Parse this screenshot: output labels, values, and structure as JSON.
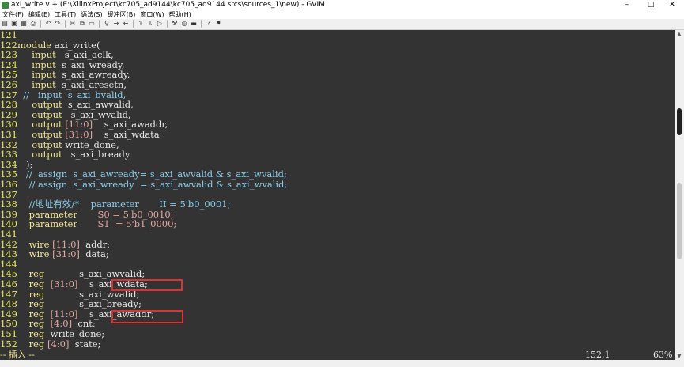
{
  "window": {
    "title": "axi_write.v + (E:\\XilinxProject\\kc705_ad9144\\kc705_ad9144.srcs\\sources_1\\new) - GVIM",
    "buttons": {
      "minimize": "–",
      "maximize": "□",
      "close": "✕"
    }
  },
  "menu": [
    "文件(F)",
    "编辑(E)",
    "工具(T)",
    "语法(S)",
    "缓冲区(B)",
    "窗口(W)",
    "帮助(H)"
  ],
  "toolbar_icons": [
    "open-icon",
    "save-icon",
    "save-all-icon",
    "print-icon",
    "undo-icon",
    "redo-icon",
    "cut-icon",
    "copy-icon",
    "paste-icon",
    "find-replace-icon",
    "find-next-icon",
    "find-prev-icon",
    "load-session-icon",
    "save-session-icon",
    "run-script-icon",
    "make-icon",
    "run-ctags-icon",
    "jump-tag-icon",
    "help-icon",
    "find-help-icon"
  ],
  "code": [
    {
      "n": "121",
      "t": []
    },
    {
      "n": "122",
      "t": [
        [
          "kw",
          "module "
        ],
        [
          "idn",
          "axi_write("
        ]
      ]
    },
    {
      "n": "123",
      "t": [
        [
          "idn",
          "     "
        ],
        [
          "typ",
          "input"
        ],
        [
          "idn",
          "   s_axi_aclk,"
        ]
      ]
    },
    {
      "n": "124",
      "t": [
        [
          "idn",
          "     "
        ],
        [
          "typ",
          "input"
        ],
        [
          "idn",
          "  s_axi_wready,"
        ]
      ]
    },
    {
      "n": "125",
      "t": [
        [
          "idn",
          "     "
        ],
        [
          "typ",
          "input"
        ],
        [
          "idn",
          "  s_axi_awready,"
        ]
      ]
    },
    {
      "n": "126",
      "t": [
        [
          "idn",
          "     "
        ],
        [
          "typ",
          "input"
        ],
        [
          "idn",
          "  s_axi_aresetn,"
        ]
      ]
    },
    {
      "n": "127",
      "t": [
        [
          "cmt",
          "  //   input  s_axi_bvalid,"
        ]
      ]
    },
    {
      "n": "128",
      "t": [
        [
          "idn",
          "     "
        ],
        [
          "typ",
          "output"
        ],
        [
          "idn",
          "  s_axi_awvalid,"
        ]
      ]
    },
    {
      "n": "129",
      "t": [
        [
          "idn",
          "     "
        ],
        [
          "typ",
          "output"
        ],
        [
          "idn",
          "   s_axi_wvalid,"
        ]
      ]
    },
    {
      "n": "130",
      "t": [
        [
          "idn",
          "     "
        ],
        [
          "typ",
          "output"
        ],
        [
          "num",
          " [11:0]"
        ],
        [
          "idn",
          "    s_axi_awaddr,"
        ]
      ]
    },
    {
      "n": "131",
      "t": [
        [
          "idn",
          "     "
        ],
        [
          "typ",
          "output"
        ],
        [
          "num",
          " [31:0]"
        ],
        [
          "idn",
          "    s_axi_wdata,"
        ]
      ]
    },
    {
      "n": "132",
      "t": [
        [
          "idn",
          "     "
        ],
        [
          "typ",
          "output"
        ],
        [
          "idn",
          " write_done,"
        ]
      ]
    },
    {
      "n": "133",
      "t": [
        [
          "idn",
          "     "
        ],
        [
          "typ",
          "output"
        ],
        [
          "idn",
          "   s_axi_bready"
        ]
      ]
    },
    {
      "n": "134",
      "t": [
        [
          "idn",
          "   );"
        ]
      ]
    },
    {
      "n": "135",
      "t": [
        [
          "cmt",
          "   //  assign  s_axi_awready= s_axi_awvalid & s_axi_wvalid;"
        ]
      ]
    },
    {
      "n": "136",
      "t": [
        [
          "cmt",
          "    // assign  s_axi_wready  = s_axi_awvalid & s_axi_wvalid;"
        ]
      ]
    },
    {
      "n": "137",
      "t": []
    },
    {
      "n": "138",
      "t": [
        [
          "cmt",
          "    //地址有效/*    parameter       II = 5'b0_0001;"
        ]
      ]
    },
    {
      "n": "139",
      "t": [
        [
          "idn",
          "    "
        ],
        [
          "typ",
          "parameter"
        ],
        [
          "idn",
          "       "
        ],
        [
          "num",
          "S0 = 5'b0_0010;"
        ]
      ]
    },
    {
      "n": "140",
      "t": [
        [
          "idn",
          "    "
        ],
        [
          "typ",
          "parameter"
        ],
        [
          "idn",
          "       "
        ],
        [
          "num",
          "S1  = 5'b1_0000;"
        ]
      ]
    },
    {
      "n": "141",
      "t": []
    },
    {
      "n": "142",
      "t": [
        [
          "idn",
          "    "
        ],
        [
          "typ",
          "wire"
        ],
        [
          "num",
          " [11:0]"
        ],
        [
          "idn",
          "  addr;"
        ]
      ]
    },
    {
      "n": "143",
      "t": [
        [
          "idn",
          "    "
        ],
        [
          "typ",
          "wire"
        ],
        [
          "num",
          " [31:0]"
        ],
        [
          "idn",
          "  data;"
        ]
      ]
    },
    {
      "n": "144",
      "t": []
    },
    {
      "n": "145",
      "t": [
        [
          "idn",
          "    "
        ],
        [
          "typ",
          "reg"
        ],
        [
          "idn",
          "            s_axi_awvalid;"
        ]
      ]
    },
    {
      "n": "146",
      "t": [
        [
          "idn",
          "    "
        ],
        [
          "typ",
          "reg"
        ],
        [
          "num",
          "  [31:0]"
        ],
        [
          "idn",
          "    s_axi_wdata;"
        ]
      ]
    },
    {
      "n": "147",
      "t": [
        [
          "idn",
          "    "
        ],
        [
          "typ",
          "reg"
        ],
        [
          "idn",
          "            s_axi_wvalid;"
        ]
      ]
    },
    {
      "n": "148",
      "t": [
        [
          "idn",
          "    "
        ],
        [
          "typ",
          "reg"
        ],
        [
          "idn",
          "            s_axi_bready;"
        ]
      ]
    },
    {
      "n": "149",
      "t": [
        [
          "idn",
          "    "
        ],
        [
          "typ",
          "reg"
        ],
        [
          "num",
          "  [11:0]"
        ],
        [
          "idn",
          "    s_axi_awaddr;"
        ]
      ]
    },
    {
      "n": "150",
      "t": [
        [
          "idn",
          "    "
        ],
        [
          "typ",
          "reg"
        ],
        [
          "num",
          "  [4:0]"
        ],
        [
          "idn",
          "  cnt;"
        ]
      ]
    },
    {
      "n": "151",
      "t": [
        [
          "idn",
          "    "
        ],
        [
          "typ",
          "reg"
        ],
        [
          "idn",
          "  write_done;"
        ]
      ]
    },
    {
      "n": "152",
      "t": [
        [
          "idn",
          "    "
        ],
        [
          "typ",
          "reg"
        ],
        [
          "num",
          " [4:0]"
        ],
        [
          "idn",
          "  state;"
        ]
      ]
    }
  ],
  "status": {
    "mode": "-- 插入 --",
    "position": "152,1",
    "percent": "63%"
  },
  "colors": {
    "editor_bg": "#333333",
    "keyword": "#f0e68c",
    "comment": "#87ceeb",
    "number": "#e2a8a0",
    "line_number": "#e8e85a",
    "highlight_box": "#e03030"
  }
}
